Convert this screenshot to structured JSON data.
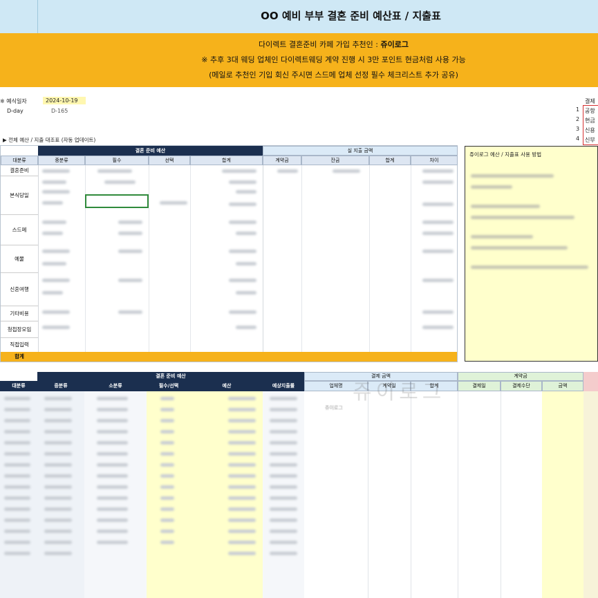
{
  "title": "OO 예비 부부 결혼 준비 예산표 / 지출표",
  "banner": {
    "line1_prefix": "다이렉트 결혼준비 카페 가입 추천인 : ",
    "line1_name": "쥬이로그",
    "line2": "※ 추후 3대 웨딩 업체인 다이렉트웨딩 계약 진행 시 3만 포인트 현금처럼 사용 가능",
    "line3": "(메일로 추천인 기입 회신 주시면 스드메 업체 선정 필수 체크리스트 추가 공유)"
  },
  "info": {
    "date_label": "※ 예식일자",
    "date_value": "2024-10-19",
    "dday_label": "D-day",
    "dday_value": "D-165"
  },
  "side_list": {
    "header": "결제",
    "numbers": [
      "1",
      "2",
      "3",
      "4"
    ],
    "items": [
      "공항",
      "현금",
      "신용",
      "신부"
    ]
  },
  "section1": {
    "title": "▶ 전체 예산 / 지출 대조표 (자동 업데이트)",
    "budget_header": "결혼 준비 예산",
    "actual_header": "실 지출 금액",
    "columns": [
      "대분류",
      "중분류",
      "필수",
      "선택",
      "합계",
      "계약금",
      "잔금",
      "합계",
      "차이"
    ],
    "categories": [
      "결혼준비",
      "본식당일",
      "스드메",
      "예물",
      "신혼여행",
      "기타비용",
      "청첩장모임",
      "직접입력"
    ],
    "total_label": "합계"
  },
  "guide": {
    "title": "쥬이로그 예산 / 지출표 사용 방법"
  },
  "section2": {
    "budget_header": "결혼 준비 예산",
    "payment_header": "결제 금액",
    "deposit_header": "계약금",
    "columns": [
      "대분류",
      "중분류",
      "소분류",
      "필수/선택",
      "예산",
      "예상지출률",
      "업체명",
      "계약일",
      "합계",
      "결제일",
      "결제수단",
      "금액"
    ],
    "vendor_sample": "쥬이로그"
  },
  "watermark": "쥬이로그"
}
